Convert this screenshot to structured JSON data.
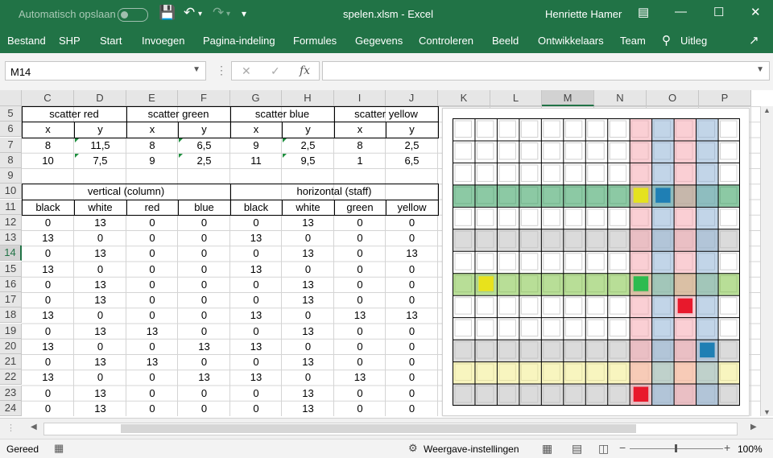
{
  "title_bar": {
    "autosave_label": "Automatisch opslaan",
    "file_title": "spelen.xlsm  -  Excel",
    "user_name": "Henriette Hamer"
  },
  "ribbon_tabs": [
    "Bestand",
    "SHP",
    "Start",
    "Invoegen",
    "Pagina-indeling",
    "Formules",
    "Gegevens",
    "Controleren",
    "Beeld",
    "Ontwikkelaars",
    "Team"
  ],
  "tell_me": "Uitleg",
  "formula_bar": {
    "name_box": "M14",
    "formula": "",
    "fx": "fx"
  },
  "columns": [
    "C",
    "D",
    "E",
    "F",
    "G",
    "H",
    "I",
    "J",
    "K",
    "L",
    "M",
    "N",
    "O",
    "P"
  ],
  "selected_column": "M",
  "rows": [
    "5",
    "6",
    "7",
    "8",
    "9",
    "10",
    "11",
    "12",
    "13",
    "14",
    "15",
    "16",
    "17",
    "18",
    "19",
    "20",
    "21",
    "22",
    "23",
    "24"
  ],
  "selected_row": "14",
  "header_row5": [
    "scatter red",
    "scatter green",
    "scatter blue",
    "scatter yellow"
  ],
  "header_row6": [
    "x",
    "y",
    "x",
    "y",
    "x",
    "y",
    "x",
    "y"
  ],
  "row7": [
    "8",
    "11,5",
    "8",
    "6,5",
    "9",
    "2,5",
    "8",
    "2,5"
  ],
  "row8": [
    "10",
    "7,5",
    "9",
    "2,5",
    "11",
    "9,5",
    "1",
    "6,5"
  ],
  "group_headers": [
    "vertical (column)",
    "horizontal (staff)"
  ],
  "header_row11": [
    "black",
    "white",
    "red",
    "blue",
    "black",
    "white",
    "green",
    "yellow"
  ],
  "table_rows": [
    [
      "0",
      "13",
      "0",
      "0",
      "0",
      "13",
      "0",
      "0"
    ],
    [
      "13",
      "0",
      "0",
      "0",
      "13",
      "0",
      "0",
      "0"
    ],
    [
      "0",
      "13",
      "0",
      "0",
      "0",
      "13",
      "0",
      "13"
    ],
    [
      "13",
      "0",
      "0",
      "0",
      "13",
      "0",
      "0",
      "0"
    ],
    [
      "0",
      "13",
      "0",
      "0",
      "0",
      "13",
      "0",
      "0"
    ],
    [
      "0",
      "13",
      "0",
      "0",
      "0",
      "13",
      "0",
      "0"
    ],
    [
      "13",
      "0",
      "0",
      "0",
      "13",
      "0",
      "13",
      "13"
    ],
    [
      "0",
      "13",
      "13",
      "0",
      "0",
      "13",
      "0",
      "0"
    ],
    [
      "13",
      "0",
      "0",
      "13",
      "13",
      "0",
      "0",
      "0"
    ],
    [
      "0",
      "13",
      "13",
      "0",
      "0",
      "13",
      "0",
      "0"
    ],
    [
      "13",
      "0",
      "0",
      "13",
      "13",
      "0",
      "13",
      "0"
    ],
    [
      "0",
      "13",
      "0",
      "0",
      "0",
      "13",
      "0",
      "0"
    ],
    [
      "0",
      "13",
      "0",
      "0",
      "0",
      "13",
      "0",
      "0"
    ]
  ],
  "board": {
    "stripe_colors": {
      "green": "#2e9d5a",
      "lime": "#7dc242",
      "yellow": "#f2ed8a",
      "gray": "#bdbdbd",
      "red": "#f5a7b1",
      "blue": "#8fb3d5"
    },
    "horizontal_stripes": [
      {
        "row": 3,
        "color": "green"
      },
      {
        "row": 5,
        "color": "gray"
      },
      {
        "row": 7,
        "color": "lime"
      },
      {
        "row": 10,
        "color": "gray"
      },
      {
        "row": 11,
        "color": "yellow"
      },
      {
        "row": 12,
        "color": "gray"
      }
    ],
    "vertical_stripes": [
      {
        "col": 8,
        "color": "red"
      },
      {
        "col": 9,
        "color": "blue"
      },
      {
        "col": 10,
        "color": "red"
      },
      {
        "col": 11,
        "color": "blue"
      }
    ],
    "markers": [
      {
        "col": 8,
        "row": 3,
        "color": "#e5e21e"
      },
      {
        "col": 9,
        "row": 3,
        "color": "#1f7fb4"
      },
      {
        "col": 1,
        "row": 7,
        "color": "#e8e21c"
      },
      {
        "col": 8,
        "row": 7,
        "color": "#2dbb4f"
      },
      {
        "col": 10,
        "row": 8,
        "color": "#e8192c"
      },
      {
        "col": 11,
        "row": 10,
        "color": "#1f7fb4"
      },
      {
        "col": 8,
        "row": 12,
        "color": "#e8192c"
      }
    ]
  },
  "status_bar": {
    "ready": "Gereed",
    "display_settings": "Weergave-instellingen",
    "zoom": "100%"
  }
}
